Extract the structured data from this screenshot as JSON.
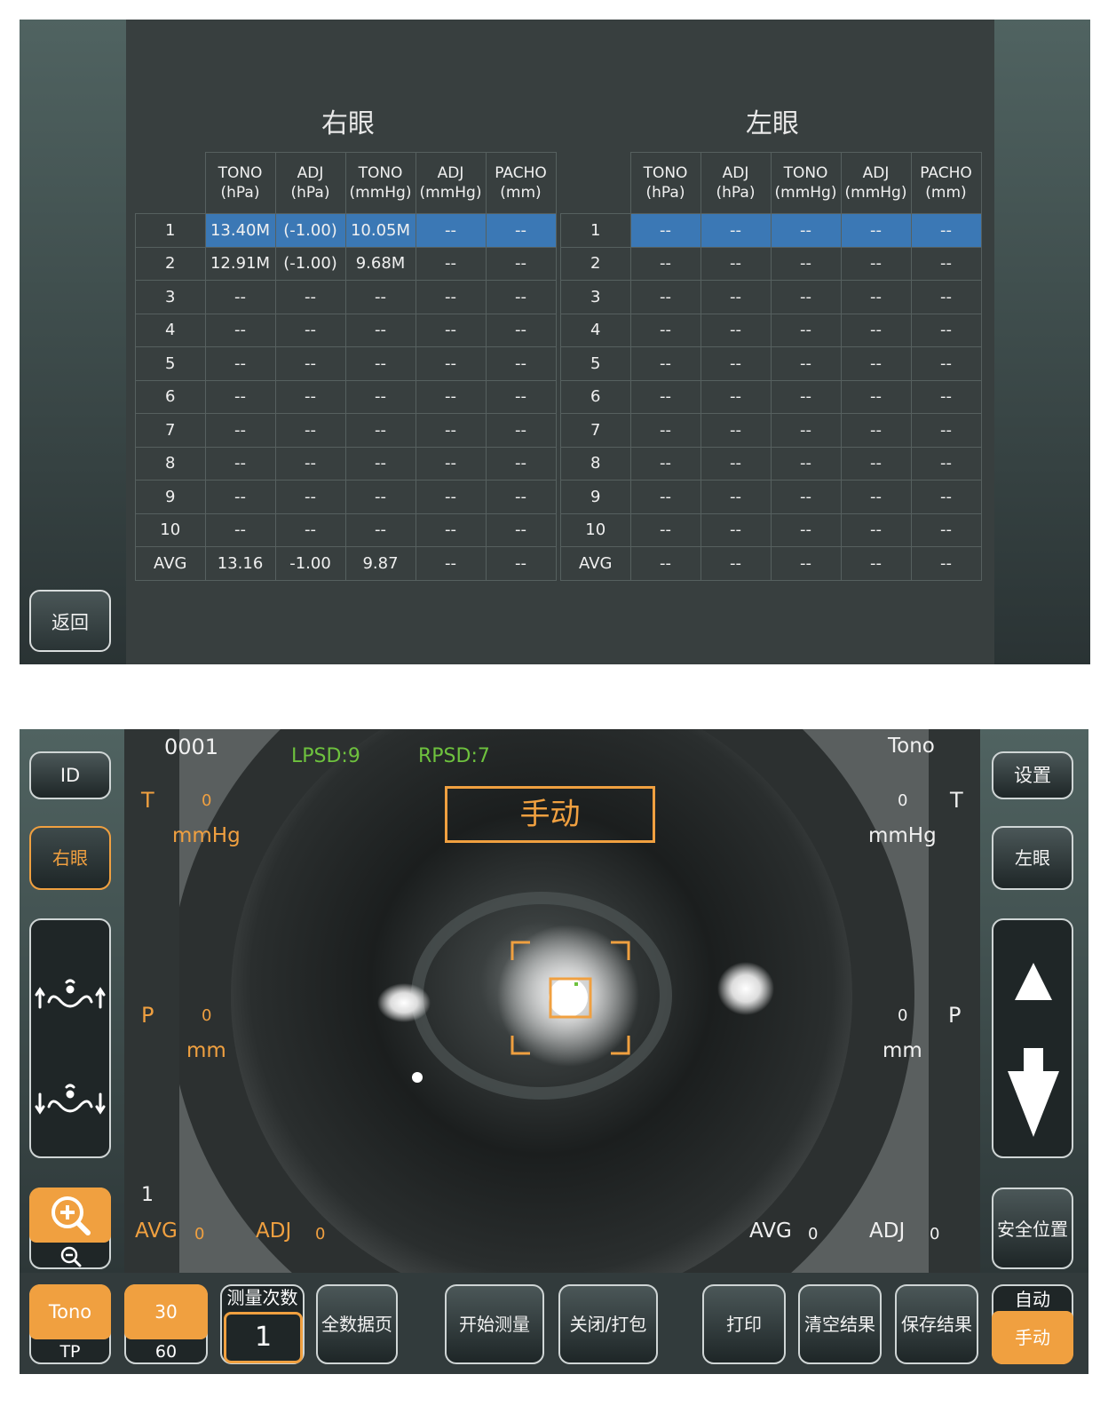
{
  "results_screen": {
    "right_eye_title": "右眼",
    "left_eye_title": "左眼",
    "headers": [
      {
        "l1": "TONO",
        "l2": "(hPa)"
      },
      {
        "l1": "ADJ",
        "l2": "(hPa)"
      },
      {
        "l1": "TONO",
        "l2": "(mmHg)"
      },
      {
        "l1": "ADJ",
        "l2": "(mmHg)"
      },
      {
        "l1": "PACHO",
        "l2": "(mm)"
      }
    ],
    "right_rows": [
      [
        "1",
        "13.40M",
        "(-1.00)",
        "10.05M",
        "--",
        "--"
      ],
      [
        "2",
        "12.91M",
        "(-1.00)",
        "9.68M",
        "--",
        "--"
      ],
      [
        "3",
        "--",
        "--",
        "--",
        "--",
        "--"
      ],
      [
        "4",
        "--",
        "--",
        "--",
        "--",
        "--"
      ],
      [
        "5",
        "--",
        "--",
        "--",
        "--",
        "--"
      ],
      [
        "6",
        "--",
        "--",
        "--",
        "--",
        "--"
      ],
      [
        "7",
        "--",
        "--",
        "--",
        "--",
        "--"
      ],
      [
        "8",
        "--",
        "--",
        "--",
        "--",
        "--"
      ],
      [
        "9",
        "--",
        "--",
        "--",
        "--",
        "--"
      ],
      [
        "10",
        "--",
        "--",
        "--",
        "--",
        "--"
      ],
      [
        "AVG",
        "13.16",
        "-1.00",
        "9.87",
        "--",
        "--"
      ]
    ],
    "left_rows": [
      [
        "1",
        "--",
        "--",
        "--",
        "--",
        "--"
      ],
      [
        "2",
        "--",
        "--",
        "--",
        "--",
        "--"
      ],
      [
        "3",
        "--",
        "--",
        "--",
        "--",
        "--"
      ],
      [
        "4",
        "--",
        "--",
        "--",
        "--",
        "--"
      ],
      [
        "5",
        "--",
        "--",
        "--",
        "--",
        "--"
      ],
      [
        "6",
        "--",
        "--",
        "--",
        "--",
        "--"
      ],
      [
        "7",
        "--",
        "--",
        "--",
        "--",
        "--"
      ],
      [
        "8",
        "--",
        "--",
        "--",
        "--",
        "--"
      ],
      [
        "9",
        "--",
        "--",
        "--",
        "--",
        "--"
      ],
      [
        "10",
        "--",
        "--",
        "--",
        "--",
        "--"
      ],
      [
        "AVG",
        "--",
        "--",
        "--",
        "--",
        "--"
      ]
    ],
    "highlight_row": 1,
    "back_button": "返回",
    "highlight_color": "#3b78b5"
  },
  "measure_screen": {
    "patient_id": "0001",
    "lpsd": "LPSD:9",
    "rpsd": "RPSD:7",
    "mode_label": "Tono",
    "manual_banner": "手动",
    "left_side": {
      "t_label": "T",
      "t_value": "0",
      "t_unit": "mmHg",
      "p_label": "P",
      "p_value": "0",
      "p_unit": "mm",
      "count": "1",
      "avg_label": "AVG",
      "avg_value": "0",
      "adj_label": "ADJ",
      "adj_value": "0"
    },
    "right_side": {
      "t_label": "T",
      "t_value": "0",
      "t_unit": "mmHg",
      "p_label": "P",
      "p_value": "0",
      "p_unit": "mm",
      "avg_label": "AVG",
      "avg_value": "0",
      "adj_label": "ADJ",
      "adj_value": "0"
    },
    "buttons": {
      "id": "ID",
      "right_eye": "右眼",
      "settings": "设置",
      "left_eye": "左眼",
      "safe_position": "安全位置",
      "tono": "Tono",
      "tp": "TP",
      "n30": "30",
      "n60": "60",
      "measure_count_label": "测量次数",
      "measure_count_value": "1",
      "all_data": "全数据页",
      "start": "开始测量",
      "close_pack": "关闭/打包",
      "print": "打印",
      "clear": "清空结果",
      "save": "保存结果",
      "auto": "自动",
      "manual": "手动"
    },
    "icons": [
      "chinrest-up-icon",
      "chinrest-down-icon",
      "zoom-in-icon",
      "zoom-out-icon",
      "arrow-up-icon",
      "arrow-down-icon"
    ],
    "accent_color": "#f0a040",
    "green_color": "#6ec23e"
  }
}
